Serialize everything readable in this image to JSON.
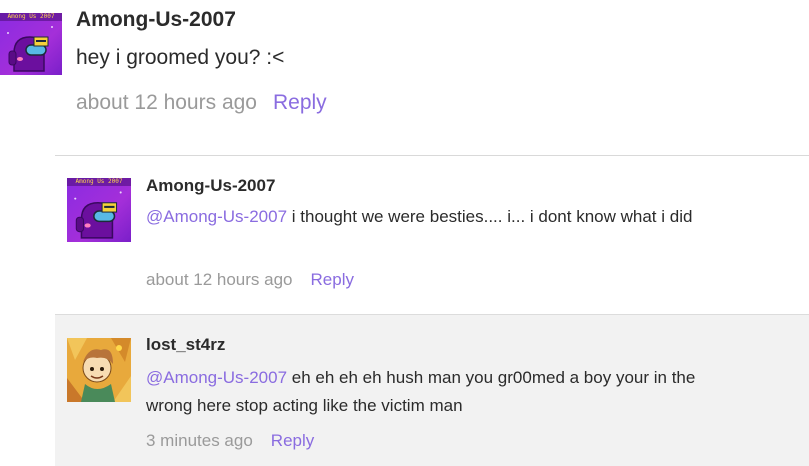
{
  "comments": [
    {
      "username": "Among-Us-2007",
      "content": "hey i groomed you? :<",
      "time": "about 12 hours ago",
      "reply_label": "Reply",
      "avatar": {
        "icon": "among-us-crewmate-avatar",
        "banner_text": "Among Us 2007"
      }
    }
  ],
  "replies": [
    {
      "username": "Among-Us-2007",
      "mention": "@Among-Us-2007",
      "content": " i thought we were besties.... i... i dont know what i did",
      "time": "about 12 hours ago",
      "reply_label": "Reply",
      "avatar": {
        "icon": "among-us-crewmate-avatar",
        "banner_text": "Among Us 2007"
      }
    },
    {
      "username": "lost_st4rz",
      "mention": "@Among-Us-2007",
      "content": " eh eh eh eh hush man you gr00med a boy your in the wrong here stop acting like the victim man",
      "time": "3 minutes ago",
      "reply_label": "Reply",
      "avatar": {
        "icon": "cartoon-character-avatar"
      }
    }
  ],
  "colors": {
    "accent": "#8a6ce0",
    "muted": "#9a9a9a",
    "text": "#2b2b2b",
    "shaded_bg": "#f2f2f2"
  }
}
